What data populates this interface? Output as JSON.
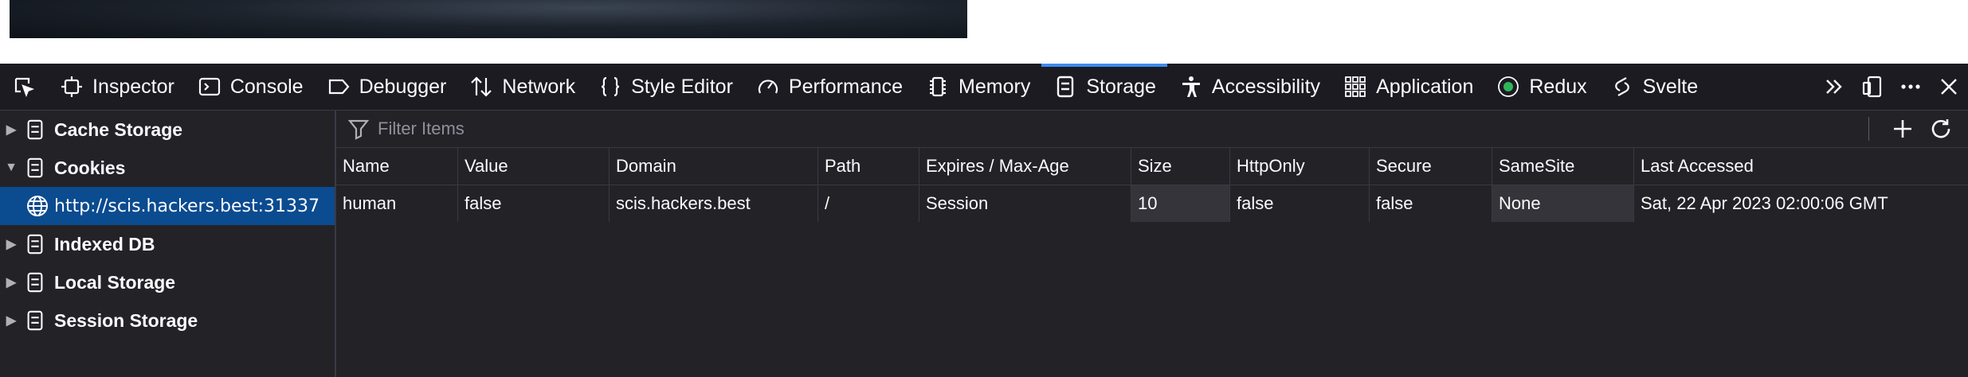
{
  "toolbar": {
    "tabs": [
      {
        "label": "Inspector",
        "icon": "inspector-icon"
      },
      {
        "label": "Console",
        "icon": "console-icon"
      },
      {
        "label": "Debugger",
        "icon": "debugger-icon"
      },
      {
        "label": "Network",
        "icon": "network-icon"
      },
      {
        "label": "Style Editor",
        "icon": "style-editor-icon"
      },
      {
        "label": "Performance",
        "icon": "performance-icon"
      },
      {
        "label": "Memory",
        "icon": "memory-icon"
      },
      {
        "label": "Storage",
        "icon": "storage-icon",
        "selected": true
      },
      {
        "label": "Accessibility",
        "icon": "accessibility-icon"
      },
      {
        "label": "Application",
        "icon": "application-icon"
      },
      {
        "label": "Redux",
        "icon": "redux-icon"
      },
      {
        "label": "Svelte",
        "icon": "svelte-icon"
      }
    ]
  },
  "sidebar": {
    "items": [
      {
        "label": "Cache Storage",
        "expanded": false
      },
      {
        "label": "Cookies",
        "expanded": true
      },
      {
        "label": "http://scis.hackers.best:31337",
        "selected": true
      },
      {
        "label": "Indexed DB",
        "expanded": false
      },
      {
        "label": "Local Storage",
        "expanded": false
      },
      {
        "label": "Session Storage",
        "expanded": false
      }
    ]
  },
  "filter": {
    "placeholder": "Filter Items"
  },
  "table": {
    "headers": [
      "Name",
      "Value",
      "Domain",
      "Path",
      "Expires / Max-Age",
      "Size",
      "HttpOnly",
      "Secure",
      "SameSite",
      "Last Accessed"
    ],
    "rows": [
      [
        "human",
        "false",
        "scis.hackers.best",
        "/",
        "Session",
        "10",
        "false",
        "false",
        "None",
        "Sat, 22 Apr 2023 02:00:06 GMT"
      ]
    ]
  },
  "colors": {
    "toolbar_bg": "#1c1b22",
    "panel_bg": "#232327",
    "selected_bg": "#0b4b8f",
    "accent": "#3d8cf0",
    "redux_green": "#30b55a"
  }
}
